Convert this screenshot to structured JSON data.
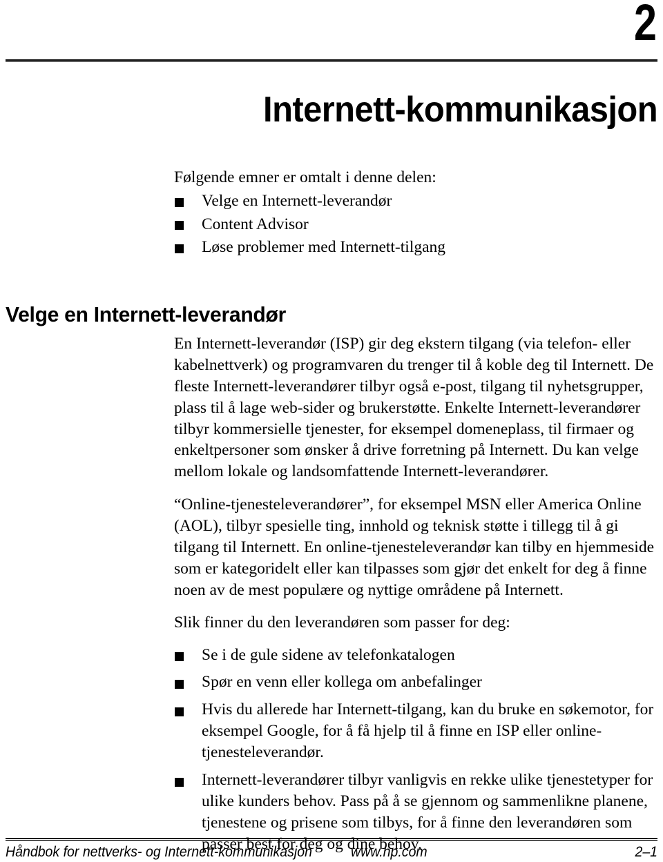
{
  "header": {
    "chapter_number": "2",
    "chapter_title": "Internett-kommunikasjon"
  },
  "intro": {
    "lead": "Følgende emner er omtalt i denne delen:",
    "topics": [
      "Velge en Internett-leverandør",
      "Content Advisor",
      "Løse problemer med Internett-tilgang"
    ]
  },
  "section": {
    "heading": "Velge en Internett-leverandør",
    "paragraphs": [
      "En Internett-leverandør (ISP) gir deg ekstern tilgang (via telefon- eller kabelnettverk) og programvaren du trenger til å koble deg til Internett. De fleste Internett-leverandører tilbyr også e-post, tilgang til nyhetsgrupper, plass til å lage web-sider og brukerstøtte. Enkelte Internett-leverandører tilbyr kommersielle tjenester, for eksempel domeneplass, til firmaer og enkeltpersoner som ønsker å drive forretning på Internett. Du kan velge mellom lokale og landsomfattende Internett-leverandører.",
      "“Online-tjenesteleverandører”, for eksempel MSN eller America Online (AOL), tilbyr spesielle ting, innhold og teknisk støtte i tillegg til å gi tilgang til Internett. En online-tjenesteleverandør kan tilby en hjemmeside som er kategoridelt eller kan tilpasses som gjør det enkelt for deg å finne noen av de mest populære og nyttige områdene på Internett."
    ],
    "list_lead": "Slik finner du den leverandøren som passer for deg:",
    "action_items": [
      "Se i de gule sidene av telefonkatalogen",
      "Spør en venn eller kollega om anbefalinger",
      "Hvis du allerede har Internett-tilgang, kan du bruke en søkemotor, for eksempel Google, for å få hjelp til å finne en ISP eller online-tjenesteleverandør.",
      "Internett-leverandører tilbyr vanligvis en rekke ulike tjenestetyper for ulike kunders behov. Pass på å se gjennom og sammenlikne planene, tjenestene og prisene som tilbys, for å finne den leverandøren som passer best for deg og dine behov."
    ]
  },
  "footer": {
    "document_title": "Håndbok for nettverks- og Internett-kommunikasjon",
    "website": "www.hp.com",
    "page_number": "2–1"
  }
}
